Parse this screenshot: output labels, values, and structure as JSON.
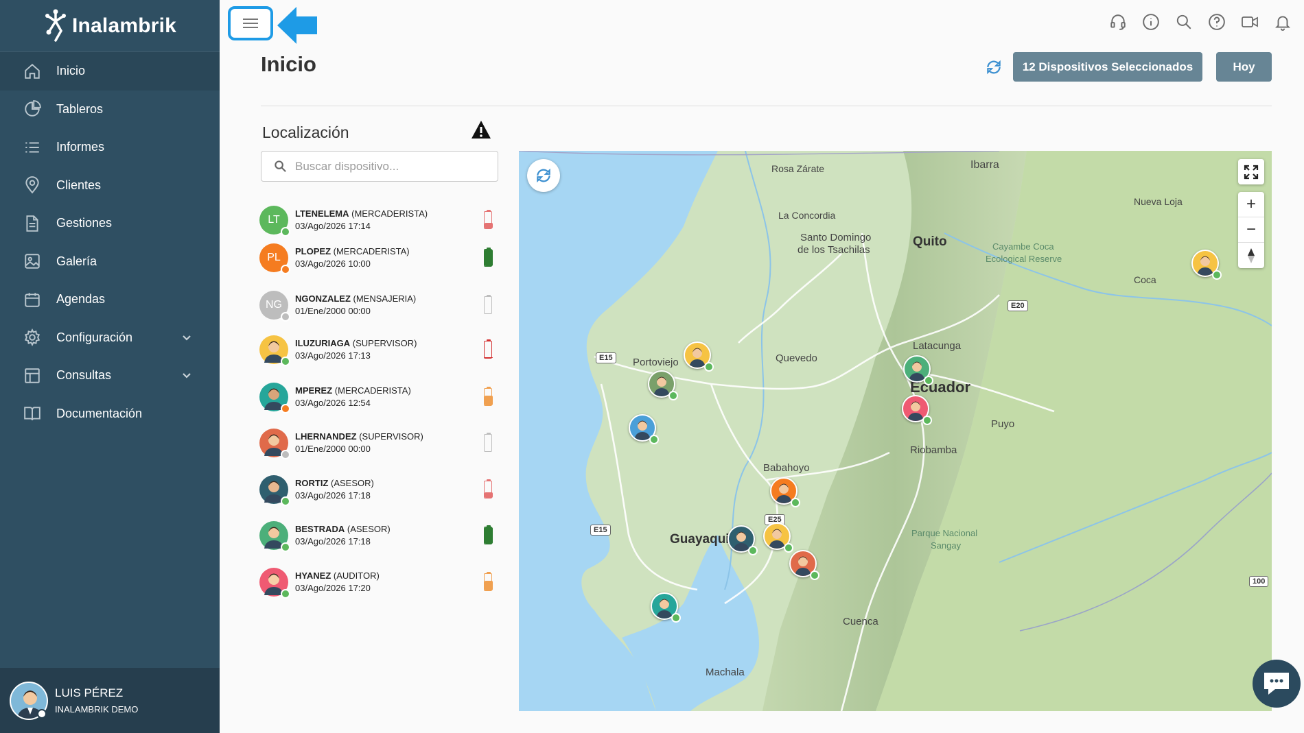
{
  "brand": {
    "name": "Inalambrik"
  },
  "sidebar": {
    "items": [
      {
        "label": "Inicio",
        "icon": "home-icon"
      },
      {
        "label": "Tableros",
        "icon": "pie-chart-icon"
      },
      {
        "label": "Informes",
        "icon": "list-icon"
      },
      {
        "label": "Clientes",
        "icon": "location-pin-icon"
      },
      {
        "label": "Gestiones",
        "icon": "document-icon"
      },
      {
        "label": "Galería",
        "icon": "image-icon"
      },
      {
        "label": "Agendas",
        "icon": "calendar-icon"
      },
      {
        "label": "Configuración",
        "icon": "gear-icon"
      },
      {
        "label": "Consultas",
        "icon": "table-icon"
      },
      {
        "label": "Documentación",
        "icon": "book-icon"
      }
    ]
  },
  "user": {
    "name": "LUIS PÉREZ",
    "org": "INALAMBRIK DEMO"
  },
  "header": {
    "title": "Inicio",
    "devices_button": "12 Dispositivos Seleccionados",
    "today_button": "Hoy"
  },
  "location": {
    "title": "Localización",
    "search_placeholder": "Buscar dispositivo...",
    "devices": [
      {
        "name": "LTENELEMA",
        "role": "(MERCADERISTA)",
        "date": "03/Ago/2026 17:14",
        "initials": "LT",
        "avatar_color": "#5cb85c",
        "status": "#5cb85c",
        "battery": "#e57373",
        "battery_level": 0.35
      },
      {
        "name": "PLOPEZ",
        "role": "(MERCADERISTA)",
        "date": "03/Ago/2026 10:00",
        "initials": "PL",
        "avatar_color": "#f57c20",
        "status": "#f57c20",
        "battery": "#2e7d32",
        "battery_level": 1.0
      },
      {
        "name": "NGONZALEZ",
        "role": "(MENSAJERIA)",
        "date": "01/Ene/2000 00:00",
        "initials": "NG",
        "avatar_color": "#bdbdbd",
        "status": "#bdbdbd",
        "battery": "#bdbdbd",
        "battery_level": 0.0
      },
      {
        "name": "ILUZURIAGA",
        "role": "(SUPERVISOR)",
        "date": "03/Ago/2026 17:13",
        "initials": "",
        "avatar_color": "#f6c343",
        "status": "#5cb85c",
        "battery": "#d32f2f",
        "battery_level": 0.05
      },
      {
        "name": "MPEREZ",
        "role": "(MERCADERISTA)",
        "date": "03/Ago/2026 12:54",
        "initials": "",
        "avatar_color": "#26a69a",
        "status": "#f57c20",
        "battery": "#f0a050",
        "battery_level": 0.6
      },
      {
        "name": "LHERNANDEZ",
        "role": "(SUPERVISOR)",
        "date": "01/Ene/2000 00:00",
        "initials": "",
        "avatar_color": "#e06a4a",
        "status": "#bdbdbd",
        "battery": "#bdbdbd",
        "battery_level": 0.0
      },
      {
        "name": "RORTIZ",
        "role": "(ASESOR)",
        "date": "03/Ago/2026 17:18",
        "initials": "",
        "avatar_color": "#2f5f6f",
        "status": "#5cb85c",
        "battery": "#e57373",
        "battery_level": 0.35
      },
      {
        "name": "BESTRADA",
        "role": "(ASESOR)",
        "date": "03/Ago/2026 17:18",
        "initials": "",
        "avatar_color": "#4caf7a",
        "status": "#5cb85c",
        "battery": "#2e7d32",
        "battery_level": 1.0
      },
      {
        "name": "HYANEZ",
        "role": "(AUDITOR)",
        "date": "03/Ago/2026 17:20",
        "initials": "",
        "avatar_color": "#ef5a72",
        "status": "#5cb85c",
        "battery": "#f0a050",
        "battery_level": 0.6
      }
    ]
  },
  "map": {
    "places": [
      "Rosa Zárate",
      "Ibarra",
      "La Concordia",
      "Santo Domingo",
      "de los Tsachilas",
      "Quito",
      "Cayambe Coca",
      "Ecological Reserve",
      "Nueva Loja",
      "Coca",
      "Portoviejo",
      "Quevedo",
      "Latacunga",
      "Ecuador",
      "Puyo",
      "Riobamba",
      "Babahoyo",
      "Guayaquil",
      "Parque Nacional",
      "Sangay",
      "Cuenca",
      "Machala"
    ],
    "roads": [
      "E15",
      "E20",
      "E15",
      "E25",
      "100"
    ]
  },
  "colors": {
    "sidebar": "#2f4f62",
    "accent": "#1e9be6",
    "button": "#678595"
  }
}
